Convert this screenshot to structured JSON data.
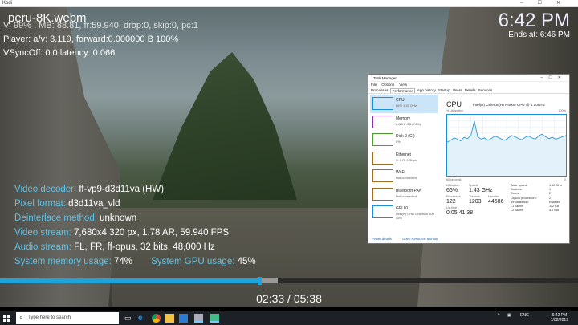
{
  "window": {
    "app_name": "Kodi",
    "controls": [
      "–",
      "☐",
      "✕"
    ]
  },
  "player": {
    "file_title": "peru-8K.webm",
    "clock": "6:42 PM",
    "ends_at": "Ends at: 6:46 PM",
    "stat_line1": "V: 99% , MB: 88.81, fr:59.940, drop:0, skip:0, pc:1",
    "stat_line2": "Player: a/v: 3.119, forward:0.000000 B 100%",
    "stat_line3": "VSyncOff: 0.0 latency: 0.066",
    "info": [
      {
        "key": "Video decoder:",
        "value": "ff-vp9-d3d11va (HW)"
      },
      {
        "key": "Pixel format:",
        "value": "d3d11va_vld"
      },
      {
        "key": "Deinterlace method:",
        "value": "unknown"
      },
      {
        "key": "Video stream:",
        "value": "7,680x4,320 px, 1.78 AR, 59.940 FPS"
      },
      {
        "key": "Audio stream:",
        "value": "FL, FR, ff-opus, 32 bits, 48,000 Hz"
      }
    ],
    "mem_key": "System memory usage:",
    "mem_value": "74%",
    "gpu_key": "System GPU usage:",
    "gpu_value": "45%",
    "progress_fraction": 0.45,
    "buffer_fraction": 0.48,
    "timecode": "02:33 / 05:38",
    "colors": {
      "accent": "#1fa3d9",
      "info_key": "#5ec3e8"
    }
  },
  "task_manager": {
    "title": "Task Manager",
    "menu": [
      "File",
      "Options",
      "View"
    ],
    "tabs": [
      "Processes",
      "Performance",
      "App history",
      "Startup",
      "Users",
      "Details",
      "Services"
    ],
    "active_tab": "Performance",
    "side_items": [
      {
        "name": "CPU",
        "sub": "66% 1.43 GHz",
        "color": "#1b8fd6",
        "selected": true
      },
      {
        "name": "Memory",
        "sub": "2.8/3.8 GB (74%)",
        "color": "#8b2fa3",
        "selected": false
      },
      {
        "name": "Disk 0 (C:)",
        "sub": "0%",
        "color": "#4aa02c",
        "selected": false
      },
      {
        "name": "Ethernet",
        "sub": "S: 0 R: 0 Kbps",
        "color": "#a36b1b",
        "selected": false
      },
      {
        "name": "Wi-Fi",
        "sub": "Not connected",
        "color": "#a36b1b",
        "selected": false
      },
      {
        "name": "Bluetooth PAN",
        "sub": "Not connected",
        "color": "#a36b1b",
        "selected": false
      },
      {
        "name": "GPU 0",
        "sub": "Intel(R) UHD Graphics 600 45%",
        "color": "#1b8fd6",
        "selected": false
      }
    ],
    "cpu_heading": "CPU",
    "cpu_model": "Intel(R) Celeron(R) N4000 CPU @ 1.10GHz",
    "util_label": "% Utilization",
    "util_max": "100%",
    "graph_left": "60 seconds",
    "graph_right": "0",
    "stats": [
      {
        "label": "Utilization",
        "value": "66%"
      },
      {
        "label": "Speed",
        "value": "1.43 GHz"
      },
      {
        "label": "Processes",
        "value": "122"
      },
      {
        "label": "Threads",
        "value": "1203"
      },
      {
        "label": "Handles",
        "value": "44686"
      },
      {
        "label": "Up time",
        "value": "0:05:41:38"
      }
    ],
    "specs": [
      {
        "k": "Base speed:",
        "v": "1.10 GHz"
      },
      {
        "k": "Sockets:",
        "v": "1"
      },
      {
        "k": "Cores:",
        "v": "2"
      },
      {
        "k": "Logical processors:",
        "v": "2"
      },
      {
        "k": "Virtualization:",
        "v": "Enabled"
      },
      {
        "k": "L1 cache:",
        "v": "112 KB"
      },
      {
        "k": "L2 cache:",
        "v": "4.0 MB"
      }
    ],
    "footer_fewer": "Fewer details",
    "footer_monitor": "Open Resource Monitor",
    "cpu_graph": [
      55,
      58,
      62,
      60,
      57,
      63,
      61,
      66,
      90,
      64,
      60,
      62,
      58,
      61,
      65,
      63,
      60,
      58,
      62,
      66,
      64,
      61,
      59,
      63,
      65,
      62,
      60,
      66,
      68,
      64,
      61,
      63,
      60,
      62,
      64,
      66
    ]
  },
  "taskbar": {
    "search_placeholder": "Type here to search",
    "lang": "ENG",
    "time": "6:42 PM",
    "date": "1/02/2019"
  }
}
